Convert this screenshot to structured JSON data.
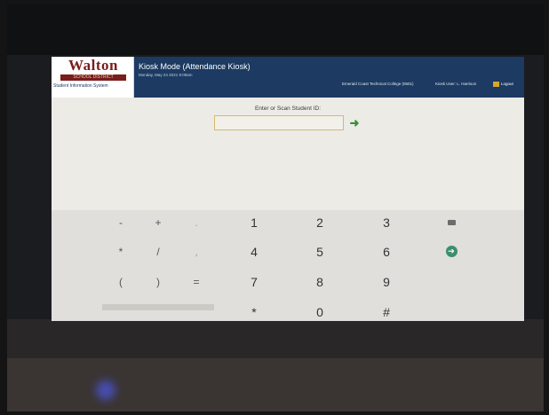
{
  "header": {
    "logo_name": "Walton",
    "logo_band_text": "SCHOOL DISTRICT",
    "logo_caption": "Student Information System",
    "title": "Kiosk Mode (Attendance Kiosk)",
    "date": "Monday, May 24 2021 9:09am",
    "school": "Emerald Coast Technical College (0601)",
    "user": "Kiosk User: L. Harrison",
    "logout_label": "Logout",
    "colors": {
      "header_bg": "#1c3a62",
      "logo_red": "#7a1d1d"
    }
  },
  "main": {
    "prompt": "Enter or Scan Student ID:",
    "student_id_value": "",
    "submit_icon": "arrow-right-icon"
  },
  "keypad": {
    "rows": [
      {
        "sym": [
          "-",
          "+",
          "."
        ],
        "num": [
          "1",
          "2",
          "3"
        ],
        "action": "backspace-icon"
      },
      {
        "sym": [
          "*",
          "/",
          ","
        ],
        "num": [
          "4",
          "5",
          "6"
        ],
        "action": "submit-circle-icon"
      },
      {
        "sym": [
          "(",
          ")",
          "="
        ],
        "num": [
          "7",
          "8",
          "9"
        ]
      },
      {
        "num": [
          "*",
          "0",
          "#"
        ]
      }
    ],
    "colors": {
      "submit": "#3d8e6e",
      "go_arrow": "#3a8f3a"
    }
  }
}
